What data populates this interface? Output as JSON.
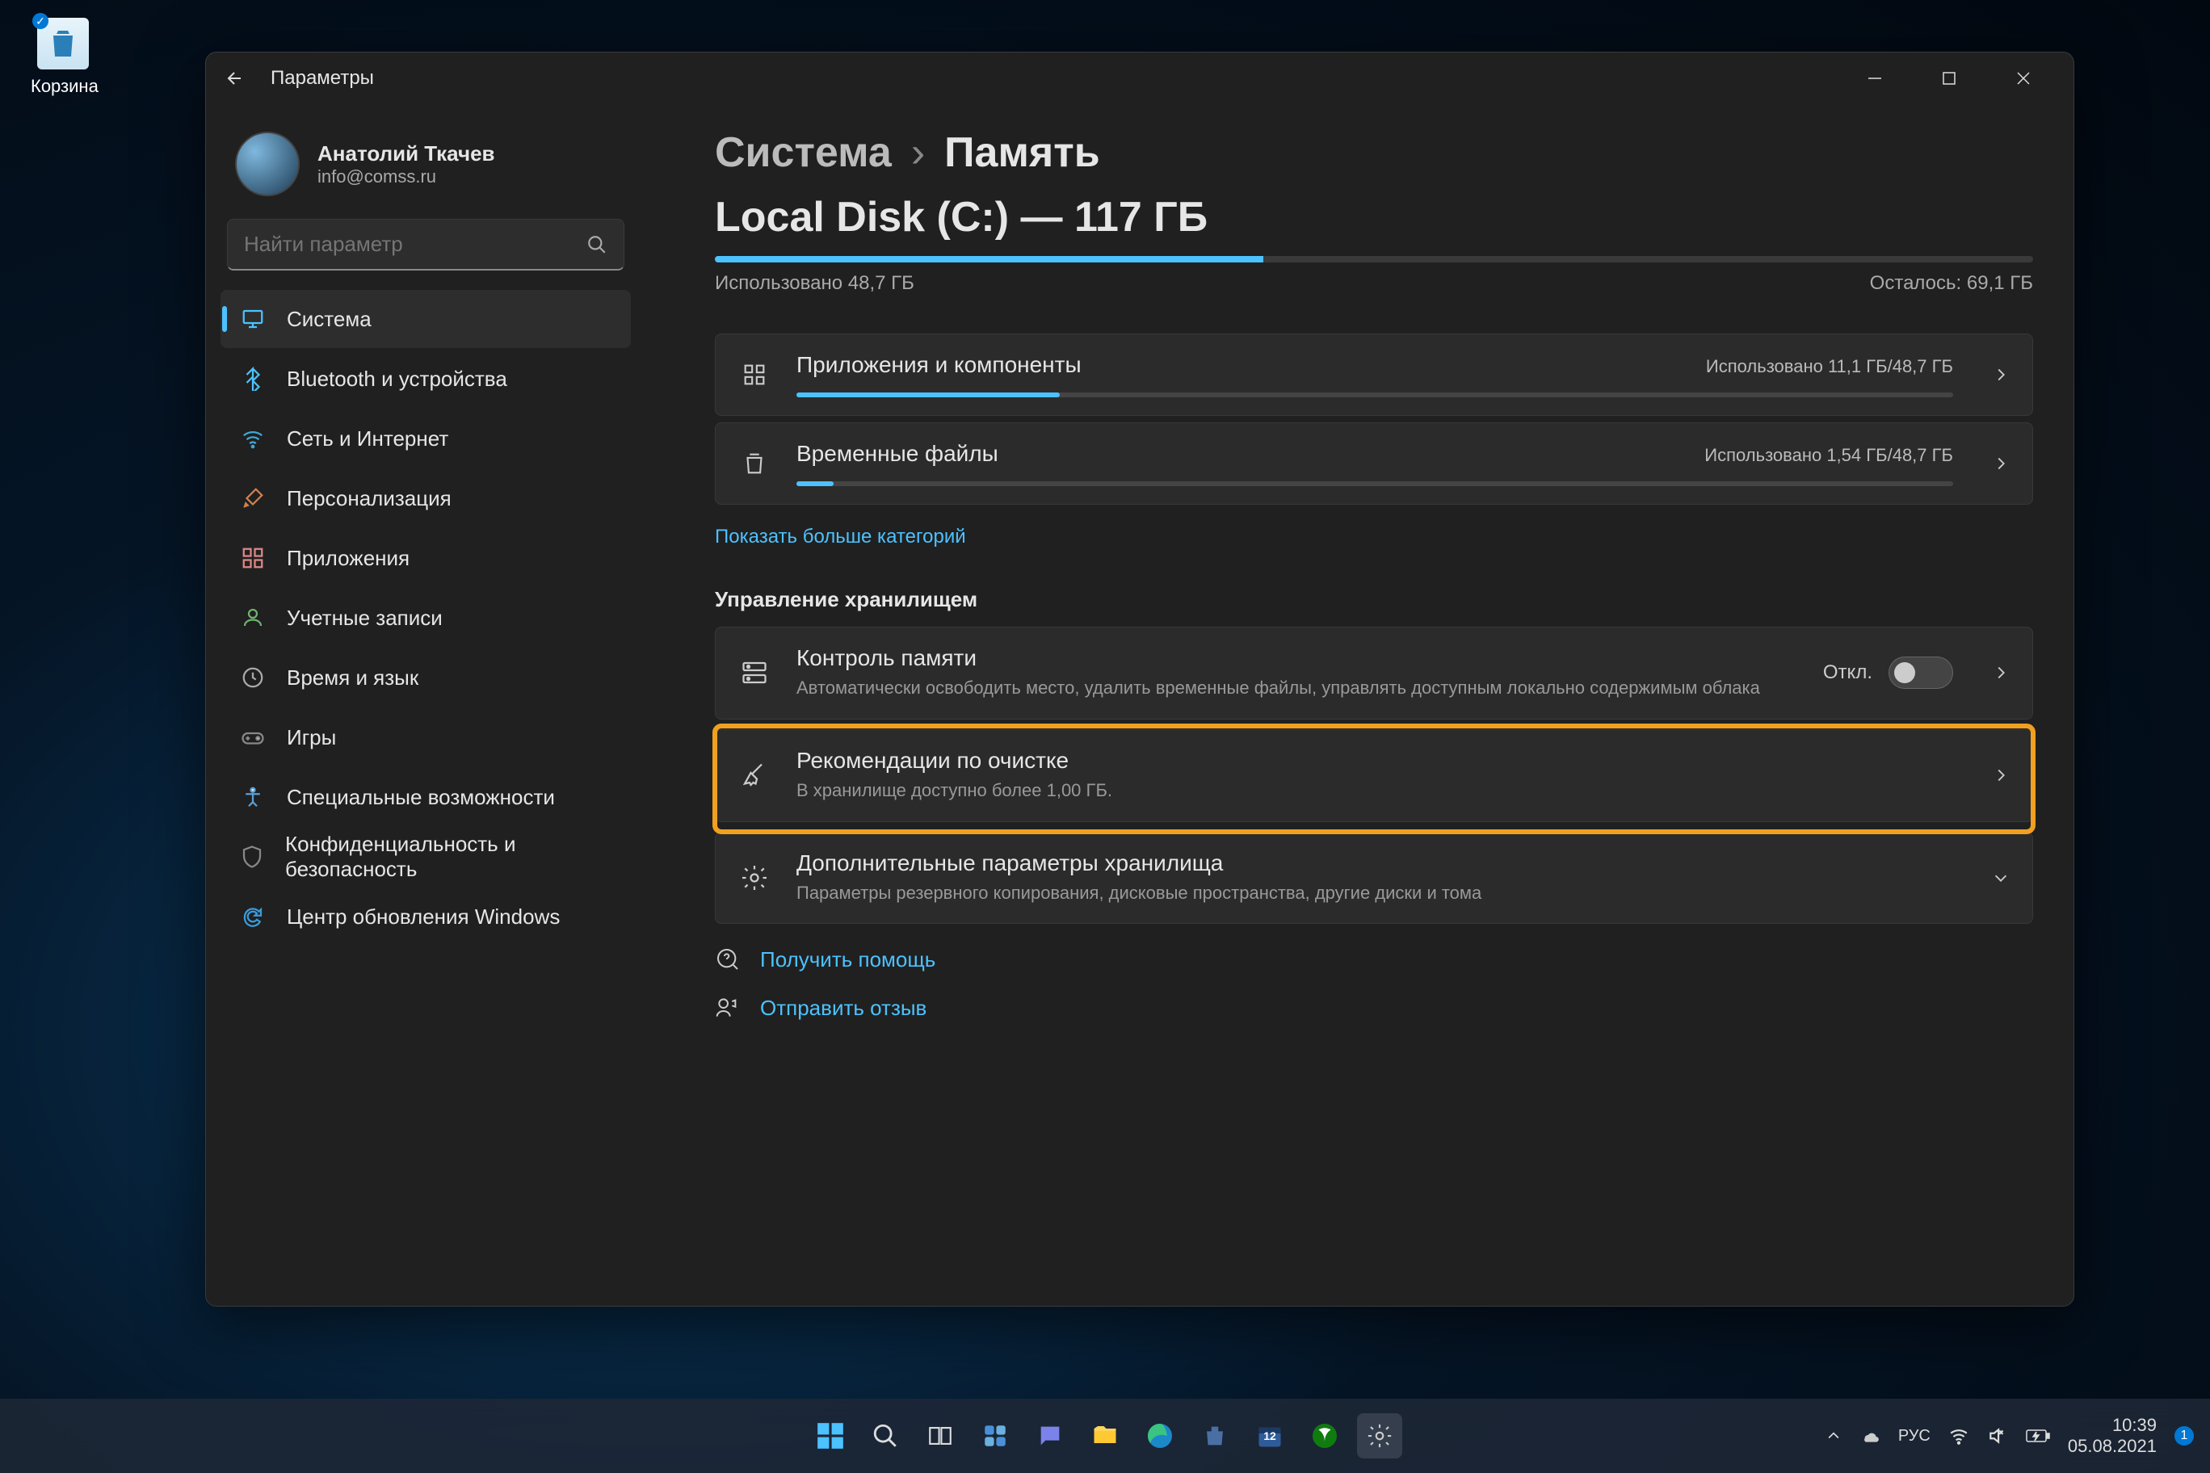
{
  "desktop": {
    "recycle_bin": "Корзина"
  },
  "window": {
    "title": "Параметры",
    "user": {
      "name": "Анатолий Ткачев",
      "email": "info@comss.ru"
    },
    "search_placeholder": "Найти параметр"
  },
  "sidebar": {
    "items": [
      {
        "label": "Система",
        "icon": "monitor",
        "color": "#4cc2ff",
        "active": true
      },
      {
        "label": "Bluetooth и устройства",
        "icon": "bluetooth",
        "color": "#4cc2ff"
      },
      {
        "label": "Сеть и Интернет",
        "icon": "wifi",
        "color": "#3fa7d6"
      },
      {
        "label": "Персонализация",
        "icon": "brush",
        "color": "#d08050"
      },
      {
        "label": "Приложения",
        "icon": "apps",
        "color": "#d88"
      },
      {
        "label": "Учетные записи",
        "icon": "person",
        "color": "#6fb36f"
      },
      {
        "label": "Время и язык",
        "icon": "clock",
        "color": "#aaa"
      },
      {
        "label": "Игры",
        "icon": "game",
        "color": "#888"
      },
      {
        "label": "Специальные возможности",
        "icon": "access",
        "color": "#5aa0d8"
      },
      {
        "label": "Конфиденциальность и безопасность",
        "icon": "shield",
        "color": "#888"
      },
      {
        "label": "Центр обновления Windows",
        "icon": "update",
        "color": "#3a9bdc"
      }
    ]
  },
  "breadcrumb": {
    "parent": "Система",
    "current": "Память"
  },
  "disk": {
    "title": "Local Disk (C:) — 117 ГБ",
    "used_label": "Использовано 48,7 ГБ",
    "free_label": "Осталось: 69,1 ГБ",
    "fill_pct": 41.6
  },
  "categories": [
    {
      "title": "Приложения и компоненты",
      "right": "Использовано 11,1 ГБ/48,7 ГБ",
      "bar_pct": 22.8,
      "icon": "grid"
    },
    {
      "title": "Временные файлы",
      "right": "Использовано 1,54 ГБ/48,7 ГБ",
      "bar_pct": 3.2,
      "icon": "trash"
    }
  ],
  "show_more": "Показать больше категорий",
  "storage_mgmt_header": "Управление хранилищем",
  "storage_sense": {
    "title": "Контроль памяти",
    "sub": "Автоматически освободить место, удалить временные файлы, управлять доступным локально содержимым облака",
    "state_label": "Откл.",
    "on": false
  },
  "cleanup": {
    "title": "Рекомендации по очистке",
    "sub": "В хранилище доступно более 1,00 ГБ."
  },
  "advanced": {
    "title": "Дополнительные параметры хранилища",
    "sub": "Параметры резервного копирования, дисковые пространства, другие диски и тома"
  },
  "footer": {
    "help": "Получить помощь",
    "feedback": "Отправить отзыв"
  },
  "taskbar": {
    "lang": "РУС",
    "time": "10:39",
    "date": "05.08.2021",
    "notif_count": "1",
    "calendar_badge": "12"
  }
}
